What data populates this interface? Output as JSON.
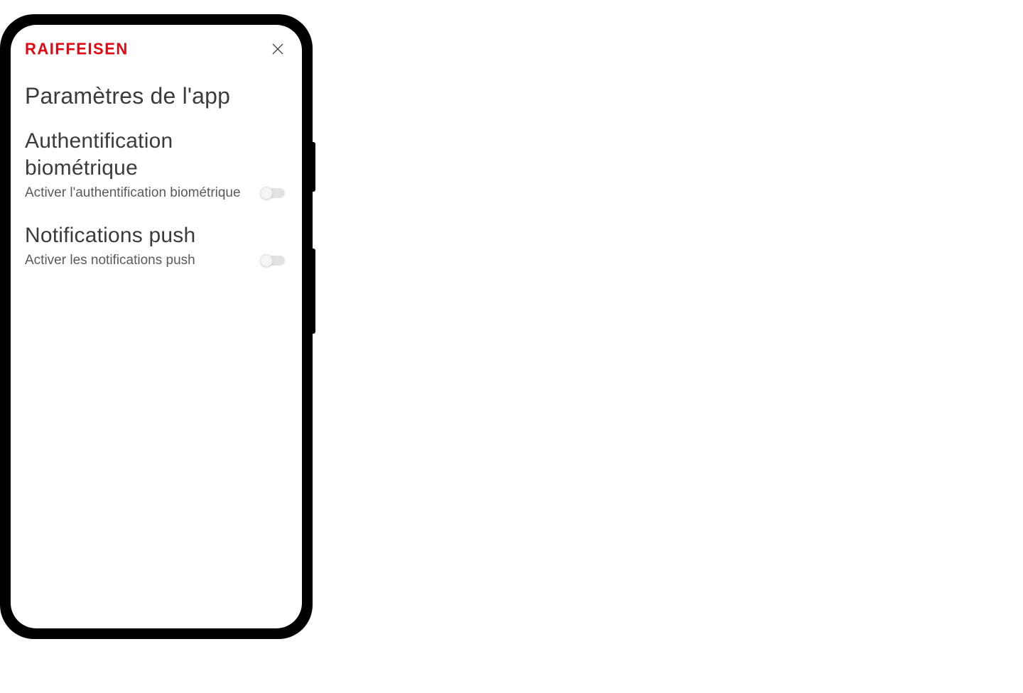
{
  "header": {
    "brand": "RAIFFEISEN"
  },
  "page": {
    "title": "Paramètres de l'app"
  },
  "sections": {
    "biometric": {
      "heading": "Authentification biométrique",
      "desc": "Activer l'authentification biométrique",
      "enabled": false
    },
    "push": {
      "heading": "Notifications push",
      "desc": "Activer les notifications push",
      "enabled": false
    }
  }
}
